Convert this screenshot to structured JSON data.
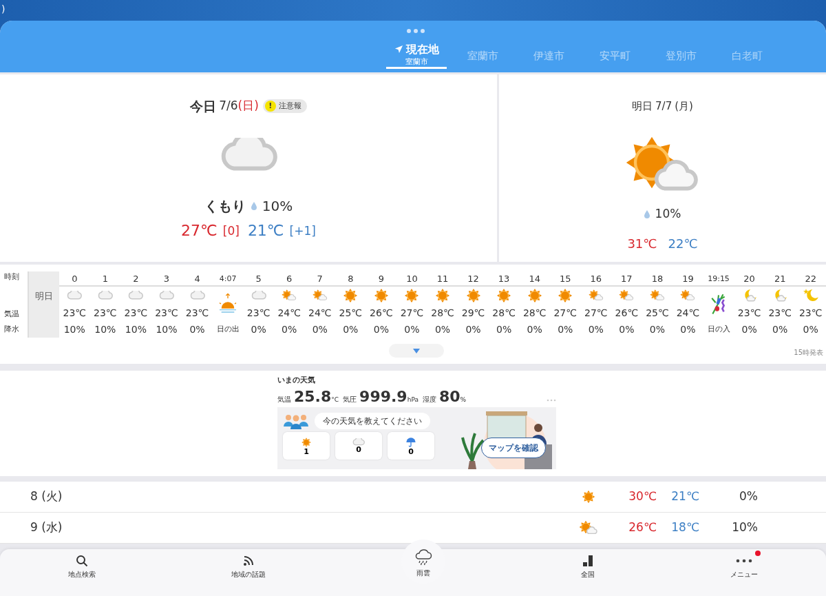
{
  "status_bar": {
    "fragment": ")"
  },
  "tabs": [
    {
      "label": "現在地",
      "sublabel": "室蘭市",
      "kind": "location",
      "selected": true
    },
    {
      "label": "室蘭市",
      "kind": "city",
      "selected": false
    },
    {
      "label": "伊達市",
      "kind": "city",
      "selected": false
    },
    {
      "label": "安平町",
      "kind": "city",
      "selected": false
    },
    {
      "label": "登別市",
      "kind": "city",
      "selected": false
    },
    {
      "label": "白老町",
      "kind": "city",
      "selected": false
    }
  ],
  "today": {
    "label": "今日",
    "date": "7/6",
    "weekday": "(日)",
    "holiday": true,
    "alert_mark": "!",
    "alert": "注意報",
    "kind": "cloudy",
    "condition": "くもり",
    "precip": "10%",
    "high": "27℃",
    "high_diff": "[0]",
    "low": "21℃",
    "low_diff": "[+1]"
  },
  "tomorrow": {
    "label": "明日",
    "date": "7/7",
    "weekday": "(月)",
    "holiday": false,
    "kind": "sun-cloud",
    "precip": "10%",
    "high": "31℃",
    "low": "22℃"
  },
  "hourly": {
    "row_labels": [
      "時刻",
      "気温",
      "降水"
    ],
    "day_label": "明日",
    "issued": "15時発表",
    "hours": [
      {
        "time": "0",
        "kind": "cloudy",
        "temp": "23℃",
        "precip": "10%"
      },
      {
        "time": "1",
        "kind": "cloudy",
        "temp": "23℃",
        "precip": "10%"
      },
      {
        "time": "2",
        "kind": "cloudy",
        "temp": "23℃",
        "precip": "10%"
      },
      {
        "time": "3",
        "kind": "cloudy",
        "temp": "23℃",
        "precip": "10%"
      },
      {
        "time": "4",
        "kind": "cloudy",
        "temp": "23℃",
        "precip": "0%"
      },
      {
        "time": "4:07",
        "kind": "sunrise",
        "event": "日の出"
      },
      {
        "time": "5",
        "kind": "cloudy",
        "temp": "23℃",
        "precip": "0%"
      },
      {
        "time": "6",
        "kind": "sun-cloud",
        "temp": "24℃",
        "precip": "0%"
      },
      {
        "time": "7",
        "kind": "sun-cloud",
        "temp": "24℃",
        "precip": "0%"
      },
      {
        "time": "8",
        "kind": "sunny",
        "temp": "25℃",
        "precip": "0%"
      },
      {
        "time": "9",
        "kind": "sunny",
        "temp": "26℃",
        "precip": "0%"
      },
      {
        "time": "10",
        "kind": "sunny",
        "temp": "27℃",
        "precip": "0%"
      },
      {
        "time": "11",
        "kind": "sunny",
        "temp": "28℃",
        "precip": "0%"
      },
      {
        "time": "12",
        "kind": "sunny",
        "temp": "29℃",
        "precip": "0%"
      },
      {
        "time": "13",
        "kind": "sunny",
        "temp": "28℃",
        "precip": "0%"
      },
      {
        "time": "14",
        "kind": "sunny",
        "temp": "28℃",
        "precip": "0%"
      },
      {
        "time": "15",
        "kind": "sunny",
        "temp": "27℃",
        "precip": "0%"
      },
      {
        "time": "16",
        "kind": "sun-cloud",
        "temp": "27℃",
        "precip": "0%"
      },
      {
        "time": "17",
        "kind": "sun-cloud",
        "temp": "26℃",
        "precip": "0%"
      },
      {
        "time": "18",
        "kind": "sun-cloud",
        "temp": "25℃",
        "precip": "0%"
      },
      {
        "time": "19",
        "kind": "sun-cloud",
        "temp": "24℃",
        "precip": "0%"
      },
      {
        "time": "19:15",
        "kind": "sunset",
        "event": "日の入"
      },
      {
        "time": "20",
        "kind": "moon-cloud",
        "temp": "23℃",
        "precip": "0%"
      },
      {
        "time": "21",
        "kind": "moon-cloud",
        "temp": "23℃",
        "precip": "0%"
      },
      {
        "time": "22",
        "kind": "moon",
        "temp": "23℃",
        "precip": "0%"
      }
    ]
  },
  "current": {
    "title": "いまの天気",
    "readings": [
      {
        "label": "気温",
        "value": "25.8",
        "unit": "°C"
      },
      {
        "label": "気圧",
        "value": "999.9",
        "unit": "hPa"
      },
      {
        "label": "湿度",
        "value": "80",
        "unit": "%"
      }
    ],
    "prompt": "今の天気を教えてください",
    "votes": [
      {
        "kind": "sunny",
        "count": "1"
      },
      {
        "kind": "cloudy",
        "count": "0"
      },
      {
        "kind": "rain",
        "count": "0"
      }
    ],
    "map_button": "マップを確認"
  },
  "daily": [
    {
      "day": "8",
      "weekday": "(火)",
      "kind": "sunny",
      "high": "30℃",
      "low": "21℃",
      "precip": "0%"
    },
    {
      "day": "9",
      "weekday": "(水)",
      "kind": "sun-cloud",
      "high": "26℃",
      "low": "18℃",
      "precip": "10%"
    }
  ],
  "nav": [
    {
      "label": "地点検索",
      "kind": "search",
      "badge": false
    },
    {
      "label": "地域の話題",
      "kind": "feed",
      "badge": false
    },
    {
      "label": "雨雲",
      "kind": "rain-radar",
      "badge": false
    },
    {
      "label": "全国",
      "kind": "map",
      "badge": false
    },
    {
      "label": "メニュー",
      "kind": "menu",
      "badge": true
    }
  ]
}
